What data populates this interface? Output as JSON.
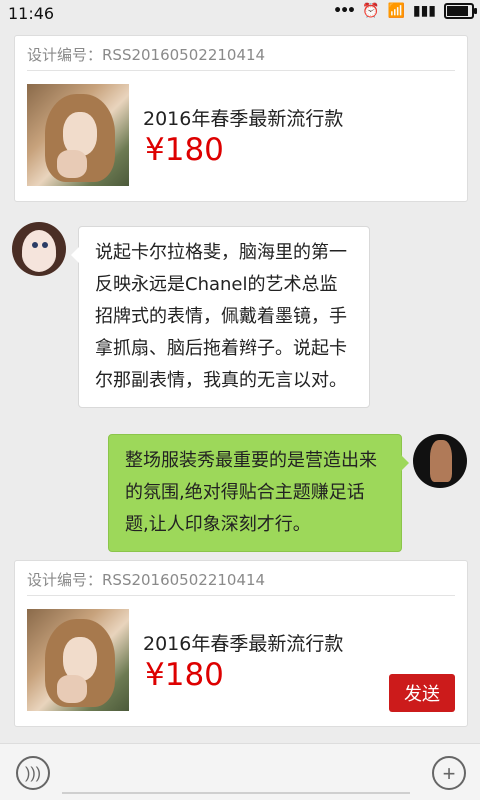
{
  "status": {
    "time": "11:46",
    "icons": [
      "more-dots-icon",
      "alarm-icon",
      "wifi-icon",
      "signal-icon",
      "battery-icon"
    ]
  },
  "cards": [
    {
      "design_code": "设计编号：RSS20160502210414",
      "title": "2016年春季最新流行款",
      "price": "¥180"
    },
    {
      "design_code": "设计编号：RSS20160502210414",
      "title": "2016年春季最新流行款",
      "price": "¥180",
      "send_label": "发送"
    }
  ],
  "messages": [
    {
      "side": "left",
      "text": "说起卡尔拉格斐，脑海里的第一反映永远是Chanel的艺术总监招牌式的表情，佩戴着墨镜，手拿抓扇、脑后拖着辫子。说起卡尔那副表情，我真的无言以对。"
    },
    {
      "side": "right",
      "text": "整场服装秀最重要的是营造出来的氛围,绝对得贴合主题赚足话题,让人印象深刻才行。"
    }
  ],
  "input": {
    "placeholder": ""
  },
  "colors": {
    "price": "#dd0000",
    "send_button": "#cc1b1b",
    "outgoing_bubble": "#9dd85a"
  }
}
